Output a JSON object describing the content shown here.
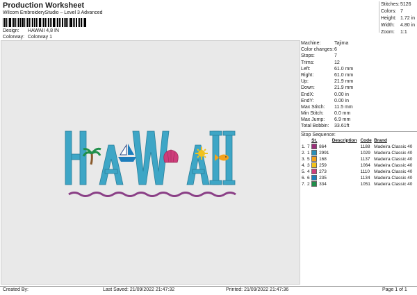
{
  "header": {
    "title": "Production Worksheet",
    "subtitle": "Wilcom EmbroideryStudio – Level 3 Advanced",
    "design_label": "Design:",
    "design_value": "HAWAII 4,8 IN",
    "colorway_label": "Colorway:",
    "colorway_value": "Colorway 1"
  },
  "stats": [
    {
      "label": "Stitches:",
      "value": "5126"
    },
    {
      "label": "Colors:",
      "value": "7"
    },
    {
      "label": "Height:",
      "value": "1.72 in"
    },
    {
      "label": "Width:",
      "value": "4.80 in"
    },
    {
      "label": "Zoom:",
      "value": "1:1"
    }
  ],
  "machine_info": [
    {
      "label": "Machine:",
      "value": "Tajima"
    },
    {
      "label": "Color changes:",
      "value": "6"
    },
    {
      "label": "Stops:",
      "value": "7"
    },
    {
      "label": "Trims:",
      "value": "12"
    },
    {
      "label": "Left:",
      "value": "61.0 mm"
    },
    {
      "label": "Right:",
      "value": "61.0 mm"
    },
    {
      "label": "Up:",
      "value": "21.9 mm"
    },
    {
      "label": "Down:",
      "value": "21.9 mm"
    },
    {
      "label": "EndX:",
      "value": "0.00 in"
    },
    {
      "label": "EndY:",
      "value": "0.00 in"
    },
    {
      "label": "Max Stitch:",
      "value": "11.5 mm"
    },
    {
      "label": "Min Stitch:",
      "value": "0.0 mm"
    },
    {
      "label": "Max Jump:",
      "value": "6.9 mm"
    },
    {
      "label": "Total Bobbin:",
      "value": "33.61ft"
    }
  ],
  "sequence": {
    "title": "Stop Sequence:",
    "headers": [
      "St.",
      "Description",
      "Code",
      "Brand"
    ],
    "rows": [
      {
        "n": "1.",
        "stop": "7",
        "color": "#9b2f7a",
        "st": "864",
        "code": "1188",
        "brand": "Madeira Classic 40"
      },
      {
        "n": "2.",
        "stop": "1",
        "color": "#2b8fb8",
        "st": "2991",
        "code": "1029",
        "brand": "Madeira Classic 40"
      },
      {
        "n": "3.",
        "stop": "5",
        "color": "#f4a21c",
        "st": "168",
        "code": "1137",
        "brand": "Madeira Classic 40"
      },
      {
        "n": "4.",
        "stop": "3",
        "color": "#f2c21b",
        "st": "259",
        "code": "1064",
        "brand": "Madeira Classic 40"
      },
      {
        "n": "5.",
        "stop": "4",
        "color": "#cf3d7b",
        "st": "273",
        "code": "1110",
        "brand": "Madeira Classic 40"
      },
      {
        "n": "6.",
        "stop": "6",
        "color": "#1d7dbb",
        "st": "235",
        "code": "1134",
        "brand": "Madeira Classic 40"
      },
      {
        "n": "7.",
        "stop": "2",
        "color": "#1f8f4a",
        "st": "334",
        "code": "1051",
        "brand": "Madeira Classic 40"
      }
    ]
  },
  "design": {
    "letters": [
      "H",
      "A",
      "W",
      "A",
      "I",
      "I"
    ],
    "letter_color": "#3ea6c6",
    "wave_color": "#8a3f86"
  },
  "footer": {
    "created_by": "Created By:",
    "last_saved": "Last Saved: 21/09/2022 21:47:32",
    "printed": "Printed: 21/09/2022 21:47:36",
    "page": "Page 1 of 1"
  }
}
